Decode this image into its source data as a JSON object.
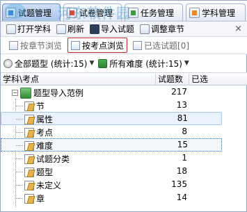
{
  "tabs": [
    {
      "label": "试题管理",
      "icon": "question-bank-icon",
      "active": true
    },
    {
      "label": "试卷管理",
      "icon": "paper-icon",
      "active": false
    },
    {
      "label": "任务管理",
      "icon": "task-icon",
      "active": false
    },
    {
      "label": "学科管理",
      "icon": "subject-icon",
      "active": false
    }
  ],
  "toolbar": {
    "open_label": "打开学科",
    "refresh_label": "刷新",
    "import_label": "导入试题",
    "adjust_label": "调整章节",
    "close_label": "×"
  },
  "subtabs": [
    {
      "label": "按章节浏览",
      "active": false
    },
    {
      "label": "按考点浏览",
      "active": true
    },
    {
      "label": "已选试题[0]",
      "active": false
    }
  ],
  "filters": {
    "type_label": "全部题型 (统计:15)",
    "difficulty_label": "所有难度 (统计:15)"
  },
  "table": {
    "columns": [
      "学科\\考点",
      "试题数",
      "已选"
    ],
    "rows": [
      {
        "name": "题型导入范例",
        "count": "217",
        "level": 0,
        "expander": "−"
      },
      {
        "name": "节",
        "count": "13",
        "level": 1
      },
      {
        "name": "属性",
        "count": "81",
        "level": 1
      },
      {
        "name": "考点",
        "count": "8",
        "level": 1
      },
      {
        "name": "难度",
        "count": "15",
        "level": 1
      },
      {
        "name": "试题分类",
        "count": "1",
        "level": 1
      },
      {
        "name": "题型",
        "count": "18",
        "level": 1
      },
      {
        "name": "未定义",
        "count": "135",
        "level": 1
      },
      {
        "name": "章",
        "count": "14",
        "level": 1
      }
    ]
  },
  "watermark": "河东软件园"
}
